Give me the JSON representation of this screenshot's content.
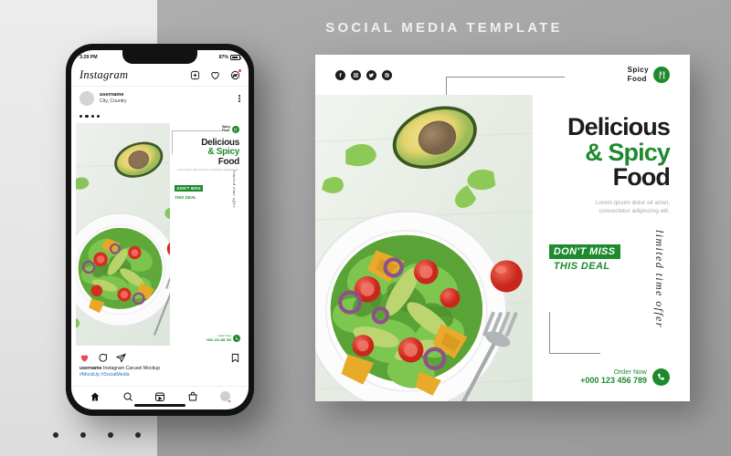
{
  "page": {
    "header_title": "SOCIAL MEDIA TEMPLATE",
    "background_color": "#a3a3a3",
    "accent_green": "#1e8a2e",
    "pagination_dots": 4
  },
  "phone": {
    "status_bar": {
      "time": "3:29 PM",
      "battery_percent": "87%"
    },
    "app_header": {
      "logo": "Instagram",
      "icons": [
        "plus-square-icon",
        "heart-icon",
        "messenger-icon"
      ]
    },
    "post": {
      "username": "username",
      "location": "City, Country",
      "carousel_dots": 4,
      "actions": [
        "heart-filled-icon",
        "comment-icon",
        "share-icon",
        "bookmark-icon"
      ],
      "caption_user": "username",
      "caption_text": "Instagram Carusel Mockup",
      "hashtags": "#MockUp #SocialMedia"
    },
    "tabbar": [
      "home-icon",
      "search-icon",
      "reels-icon",
      "shop-icon",
      "profile-avatar"
    ],
    "flyer": {
      "logo_line1": "Spicy",
      "logo_line2": "Food",
      "headline_1": "Delicious",
      "headline_2": "& Spicy",
      "headline_3": "Food",
      "subtext": "Lorem ipsum dolor sit amet, consectetur adipiscing elit.",
      "badge_1": "DON'T MISS",
      "badge_2": "THIS DEAL",
      "script": "limited time offer",
      "order_label": "Order Now",
      "order_phone": "+000 123 456 789"
    }
  },
  "poster": {
    "socials": [
      "facebook-icon",
      "instagram-icon",
      "twitter-icon",
      "dribbble-icon"
    ],
    "logo_line1": "Spicy",
    "logo_line2": "Food",
    "headline_1": "Delicious",
    "headline_2": "& Spicy",
    "headline_3": "Food",
    "subtext_line1": "Lorem ipsum dolor sit amet,",
    "subtext_line2": "consectetur adipiscing elit.",
    "badge_1": "DON'T MISS",
    "badge_2": "THIS DEAL",
    "script": "limited time offer",
    "order_label": "Order Now",
    "order_phone": "+000 123 456 789"
  }
}
